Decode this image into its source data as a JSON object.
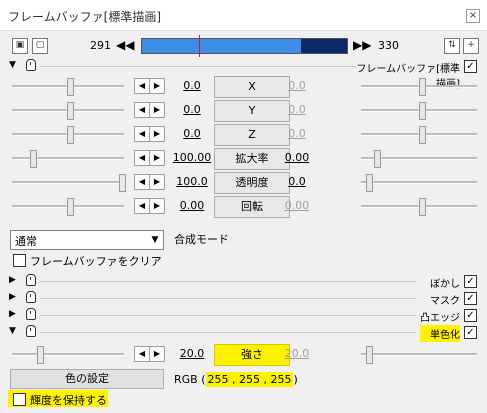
{
  "window": {
    "title": "フレームバッファ[標準描画]",
    "close_glyph": "×"
  },
  "frame": {
    "start": "291",
    "end": "330",
    "prev_glyph": "◀◀",
    "next_glyph": "▶▶",
    "loop_glyph": "⇅",
    "add_glyph": "+"
  },
  "object": {
    "name": "フレームバッファ[標準描画]"
  },
  "params": [
    {
      "left": "0.0",
      "label": "X",
      "right": "0.0",
      "right_active": false
    },
    {
      "left": "0.0",
      "label": "Y",
      "right": "0.0",
      "right_active": false
    },
    {
      "left": "0.0",
      "label": "Z",
      "right": "0.0",
      "right_active": false
    },
    {
      "left": "100.00",
      "label": "拡大率",
      "right": "0.00",
      "right_active": true
    },
    {
      "left": "100.0",
      "label": "透明度",
      "right": "0.0",
      "right_active": true
    },
    {
      "left": "0.00",
      "label": "回転",
      "right": "0.00",
      "right_active": false
    }
  ],
  "blend": {
    "value": "通常",
    "label": "合成モード"
  },
  "clear": {
    "label": "フレームバッファをクリア",
    "checked": false
  },
  "filters": [
    {
      "name": "ぼかし",
      "expanded": false,
      "checked": true,
      "highlighted": false
    },
    {
      "name": "マスク",
      "expanded": false,
      "checked": true,
      "highlighted": false
    },
    {
      "name": "凸エッジ",
      "expanded": false,
      "checked": true,
      "highlighted": false
    },
    {
      "name": "単色化",
      "expanded": true,
      "checked": true,
      "highlighted": true
    }
  ],
  "mono": {
    "strength": {
      "left": "20.0",
      "label": "強さ",
      "right": "20.0"
    },
    "color_button": "色の設定",
    "rgb_prefix": "RGB (",
    "rgb_value": "255 , 255 , 255",
    "rgb_suffix": ")",
    "keep_luma": "輝度を保持する"
  }
}
